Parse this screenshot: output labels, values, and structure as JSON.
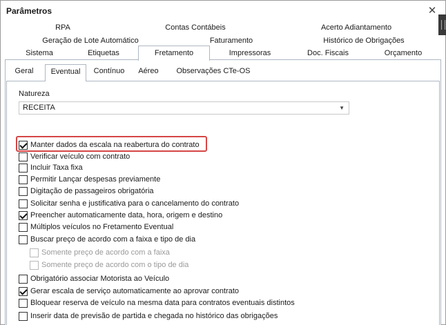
{
  "window": {
    "title": "Parâmetros"
  },
  "tabs": {
    "row1": [
      "RPA",
      "Contas Contábeis",
      "Acerto Adiantamento"
    ],
    "row2": [
      "Geração de Lote Automático",
      "Faturamento",
      "Histórico de Obrigações"
    ],
    "row3": [
      "Sistema",
      "Etiquetas",
      "Fretamento",
      "Impressoras",
      "Doc. Fiscais",
      "Orçamento"
    ],
    "active": "Fretamento"
  },
  "subtabs": {
    "items": [
      "Geral",
      "Eventual",
      "Contínuo",
      "Aéreo",
      "Observações CTe-OS"
    ],
    "active": "Eventual"
  },
  "natureza": {
    "label": "Natureza",
    "value": "RECEITA"
  },
  "options": [
    {
      "label": "Manter dados da escala na reabertura do contrato",
      "checked": true,
      "enabled": true,
      "highlighted": true
    },
    {
      "label": "Verificar veículo com contrato",
      "checked": false,
      "enabled": true
    },
    {
      "label": "Incluir Taxa fixa",
      "checked": false,
      "enabled": true
    },
    {
      "label": "Permitir Lançar despesas previamente",
      "checked": false,
      "enabled": true
    },
    {
      "label": "Digitação de passageiros obrigatória",
      "checked": false,
      "enabled": true
    },
    {
      "label": "Solicitar senha e justificativa para o cancelamento do contrato",
      "checked": false,
      "enabled": true
    },
    {
      "label": "Preencher automaticamente data, hora, origem e destino",
      "checked": true,
      "enabled": true
    },
    {
      "label": "Múltiplos veículos no Fretamento Eventual",
      "checked": false,
      "enabled": true
    },
    {
      "label": "Buscar preço de acordo com a faixa e tipo de dia",
      "checked": false,
      "enabled": true
    },
    {
      "label": "Somente preço de acordo com a faixa",
      "checked": false,
      "enabled": false,
      "indent": true
    },
    {
      "label": "Somente preço de acordo com o tipo de dia",
      "checked": false,
      "enabled": false,
      "indent": true
    },
    {
      "label": "Obrigatório associar Motorista ao Veículo",
      "checked": false,
      "enabled": true
    },
    {
      "label": "Gerar escala de serviço automaticamente ao aprovar contrato",
      "checked": true,
      "enabled": true
    },
    {
      "label": "Bloquear reserva de veículo na mesma data para contratos eventuais distintos",
      "checked": false,
      "enabled": true
    },
    {
      "label": "Inserir data de previsão de partida e chegada no histórico das obrigações",
      "checked": false,
      "enabled": true
    }
  ],
  "icons": {
    "close": "close-icon",
    "dropdown": "chevron-down-icon"
  },
  "colors": {
    "highlight": "#d64545",
    "tab_border": "#aeb7c2"
  }
}
